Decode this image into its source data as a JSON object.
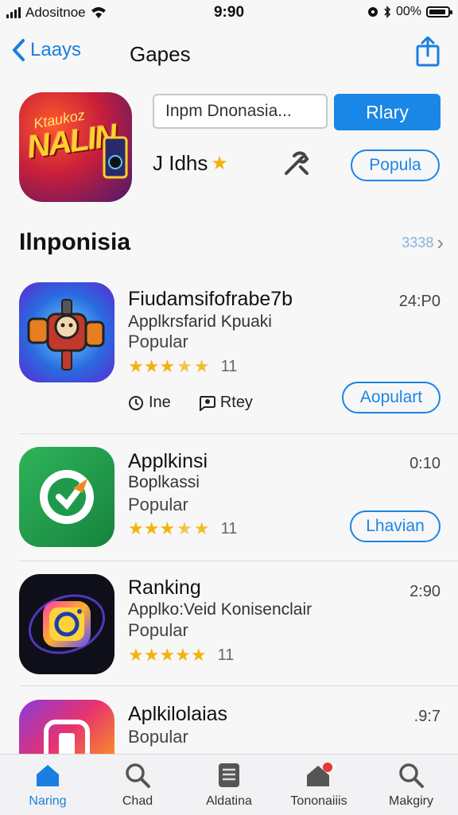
{
  "status_bar": {
    "carrier": "Adositnoe",
    "time": "9:90",
    "battery": "00%"
  },
  "nav": {
    "back_label": "Laays",
    "title": "Gapes"
  },
  "hero": {
    "logo_top": "Ktaukoz",
    "logo_text": "NALIN",
    "search_value": "Inpm Dnonasia...",
    "play_label": "Rlary",
    "rating_text": "J Idhs",
    "popula_label": "Popula"
  },
  "section": {
    "title": "Ilnponisia",
    "link": "3338"
  },
  "apps": [
    {
      "name": "Fiudamsifofrabe7b",
      "subtitle": "Applkrsfarid Kpuaki",
      "category": "Popular",
      "rating": 3.5,
      "rating_count": "11",
      "time": "24:P0",
      "action": "Aopulart",
      "meta_left": "Ine",
      "meta_right": "Rtey"
    },
    {
      "name": "Applkinsi",
      "subtitle": "Boplkassi",
      "category": "Popular",
      "rating": 3.5,
      "rating_count": "11",
      "time": "0:10",
      "action": "Lhavian"
    },
    {
      "name": "Ranking",
      "subtitle": "Applko:Veid Konisenclair",
      "category": "Popular",
      "rating": 5,
      "rating_count": "11",
      "time": "2:90"
    },
    {
      "name": "Aplkilolaias",
      "subtitle": "Bopular",
      "time": ".9:7"
    }
  ],
  "tabs": [
    {
      "label": "Naring",
      "icon": "home-icon"
    },
    {
      "label": "Chad",
      "icon": "search-icon"
    },
    {
      "label": "Aldatina",
      "icon": "document-icon"
    },
    {
      "label": "Tononaiiis",
      "icon": "house-badge-icon",
      "badge": "1"
    },
    {
      "label": "Makgiry",
      "icon": "search-icon"
    }
  ],
  "colors": {
    "accent": "#1a86e6",
    "star": "#f4b30a",
    "badge": "#e53935"
  }
}
